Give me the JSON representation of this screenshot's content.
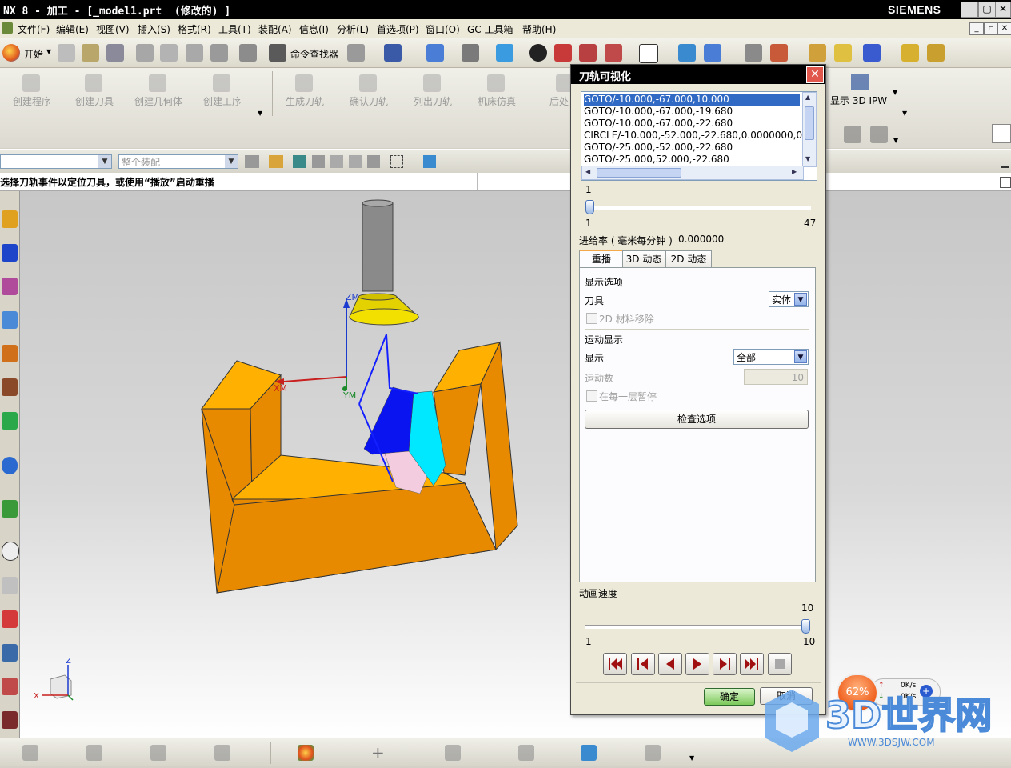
{
  "window": {
    "title": "NX 8 - 加工 - [_model1.prt  (修改的) ]",
    "brand": "SIEMENS",
    "controls": [
      "_",
      "▢",
      "✕"
    ]
  },
  "menu": {
    "items": [
      "文件(F)",
      "编辑(E)",
      "视图(V)",
      "插入(S)",
      "格式(R)",
      "工具(T)",
      "装配(A)",
      "信息(I)",
      "分析(L)",
      "首选项(P)",
      "窗口(O)",
      "GC 工具箱",
      "帮助(H)"
    ]
  },
  "toolbar": {
    "start_label": "开始",
    "command_finder_label": "命令查找器"
  },
  "toolbar2": {
    "buttons": [
      "创建程序",
      "创建刀具",
      "创建几何体",
      "创建工序",
      "生成刀轨",
      "确认刀轨",
      "列出刀轨",
      "机床仿真",
      "后处"
    ],
    "show_ipw_label": "显示 3D IPW"
  },
  "selection_bar": {
    "filter_value": "",
    "scope_value": "整个装配"
  },
  "cue_line": "选择刀轨事件以定位刀具，或使用“播放”启动重播",
  "viewport": {
    "axis_labels": {
      "zm": "ZM",
      "xm": "XM",
      "ym": "YM",
      "z": "Z",
      "x": "X"
    }
  },
  "dialog": {
    "title": "刀轨可视化",
    "events": [
      "GOTO/-10.000,-67.000,10.000",
      "GOTO/-10.000,-67.000,-19.680",
      "GOTO/-10.000,-67.000,-22.680",
      "CIRCLE/-10.000,-52.000,-22.680,0.0000000,0",
      "GOTO/-25.000,-52.000,-22.680",
      "GOTO/-25.000,52.000,-22.680"
    ],
    "event_slider": {
      "value": 1,
      "min": 1,
      "max": 47,
      "value_label": "1",
      "min_label": "1",
      "max_label": "47"
    },
    "feed_rate_label": "进给率 ( 毫米每分钟 )",
    "feed_rate_value": "0.000000",
    "tabs": [
      "重播",
      "3D 动态",
      "2D 动态"
    ],
    "display_options_label": "显示选项",
    "tool_label": "刀具",
    "tool_value": "实体",
    "material_removal_label": "2D 材料移除",
    "motion_display_label": "运动显示",
    "display_label": "显示",
    "display_value": "全部",
    "motion_count_label": "运动数",
    "motion_count_value": "10",
    "pause_each_layer_label": "在每一层暂停",
    "check_options_label": "检查选项",
    "anim_speed_label": "动画速度",
    "anim_speed": {
      "value": 10,
      "min": 1,
      "max": 10,
      "value_label": "10",
      "min_label": "1",
      "max_label": "10"
    },
    "ok_label": "确定",
    "cancel_label": "取消"
  },
  "status_widget": {
    "percent": "62%",
    "up_rate": "0K/s",
    "down_rate": "0K/s"
  },
  "watermark": {
    "text": "3D世界网",
    "url": "WWW.3DSJW.COM"
  }
}
